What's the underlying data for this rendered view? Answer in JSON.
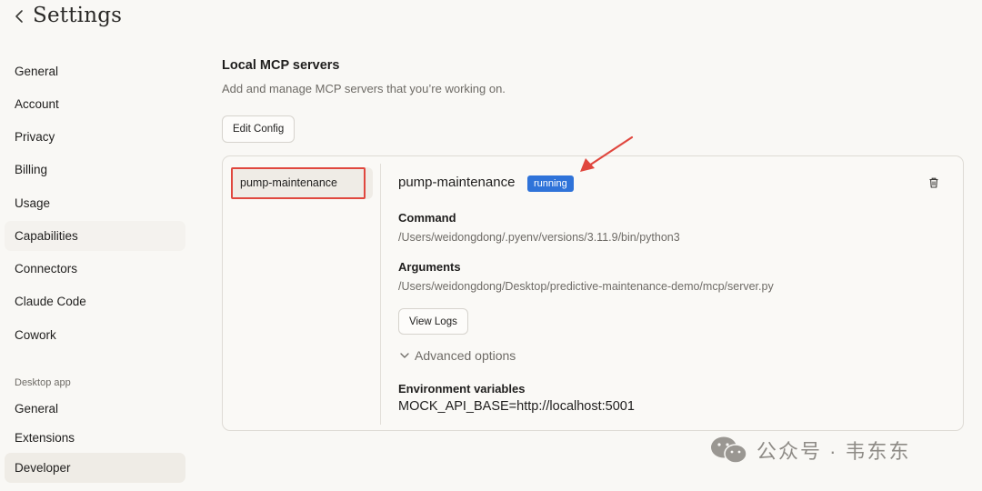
{
  "header": {
    "title": "Settings"
  },
  "sidebar": {
    "items": [
      {
        "label": "General"
      },
      {
        "label": "Account"
      },
      {
        "label": "Privacy"
      },
      {
        "label": "Billing"
      },
      {
        "label": "Usage"
      },
      {
        "label": "Capabilities"
      },
      {
        "label": "Connectors"
      },
      {
        "label": "Claude Code"
      },
      {
        "label": "Cowork"
      }
    ],
    "section_label": "Desktop app",
    "desktop_items": [
      {
        "label": "General"
      },
      {
        "label": "Extensions"
      },
      {
        "label": "Developer",
        "active": true
      }
    ]
  },
  "main": {
    "title": "Local MCP servers",
    "description": "Add and manage MCP servers that you’re working on.",
    "edit_config_label": "Edit Config",
    "servers": [
      {
        "name": "pump-maintenance",
        "selected": true
      }
    ],
    "detail": {
      "name": "pump-maintenance",
      "status": "running",
      "command_label": "Command",
      "command_value": "/Users/weidongdong/.pyenv/versions/3.11.9/bin/python3",
      "arguments_label": "Arguments",
      "arguments_value": "/Users/weidongdong/Desktop/predictive-maintenance-demo/mcp/server.py",
      "view_logs_label": "View Logs",
      "advanced_label": "Advanced options",
      "env_label": "Environment variables",
      "env_value": "MOCK_API_BASE=http://localhost:5001"
    }
  },
  "watermark": {
    "text": "公众号 · 韦东东"
  },
  "colors": {
    "background": "#f9f8f5",
    "badge": "#2f73d9",
    "annotation": "#e0473e",
    "active_nav": "#efece6"
  }
}
